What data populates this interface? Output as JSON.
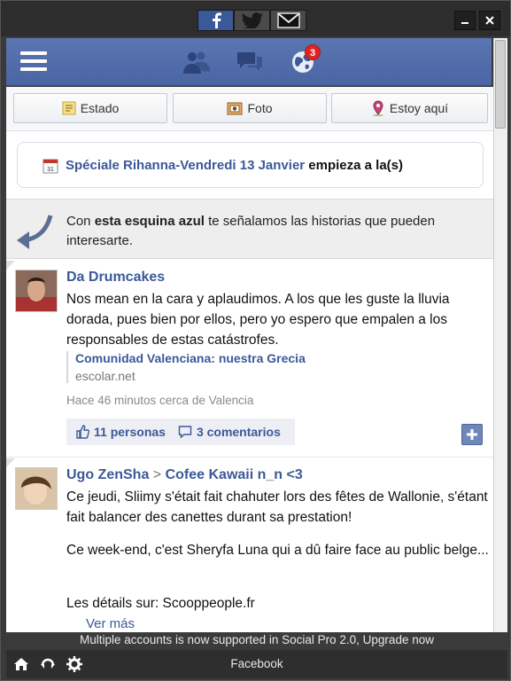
{
  "titlebar": {
    "services": [
      {
        "name": "facebook",
        "icon": "facebook-icon"
      },
      {
        "name": "twitter",
        "icon": "twitter-icon"
      },
      {
        "name": "gmail",
        "icon": "gmail-icon"
      }
    ],
    "minimize_glyph": "–",
    "close_glyph": "✕"
  },
  "appbar": {
    "notification_count": "3",
    "accent": "#4a65a3"
  },
  "actions": {
    "estado": "Estado",
    "foto": "Foto",
    "estoy_aqui": "Estoy aquí"
  },
  "event": {
    "link": "Spéciale Rihanna-Vendredi 13 Janvier",
    "rest": " empieza a la(s)",
    "calendar_day": "31"
  },
  "hint": {
    "pre": "Con ",
    "bold": "esta esquina azul",
    "post": " te señalamos las historias que pueden interesarte."
  },
  "posts": [
    {
      "author": "Da Drumcakes",
      "body": "Nos mean en la cara y aplaudimos. A los que les guste la lluvia dorada, pues bien por ellos, pero yo espero que empalen a los responsables de estas catástrofes.",
      "share_title": "Comunidad Valenciana: nuestra Grecia",
      "share_domain": "escolar.net",
      "meta": "Hace 46 minutos cerca de Valencia",
      "likes": "11 personas",
      "comments": "3 comentarios"
    },
    {
      "author": "Ugo ZenSha",
      "separator": ">",
      "target": "Cofee Kawaii n_n <3",
      "body_p1": "Ce jeudi, Sliimy s'était fait chahuter lors des fêtes de Wallonie, s'étant fait balancer des canettes durant sa prestation!",
      "body_p2": "Ce week-end, c'est Sheryfa Luna qui a dû faire face au public belge...",
      "body_p3": "Les détails sur: Scooppeople.fr",
      "more": "Ver más"
    }
  ],
  "footer": {
    "promo": "Multiple accounts is now supported in Social Pro 2.0, Upgrade now",
    "label": "Facebook"
  }
}
